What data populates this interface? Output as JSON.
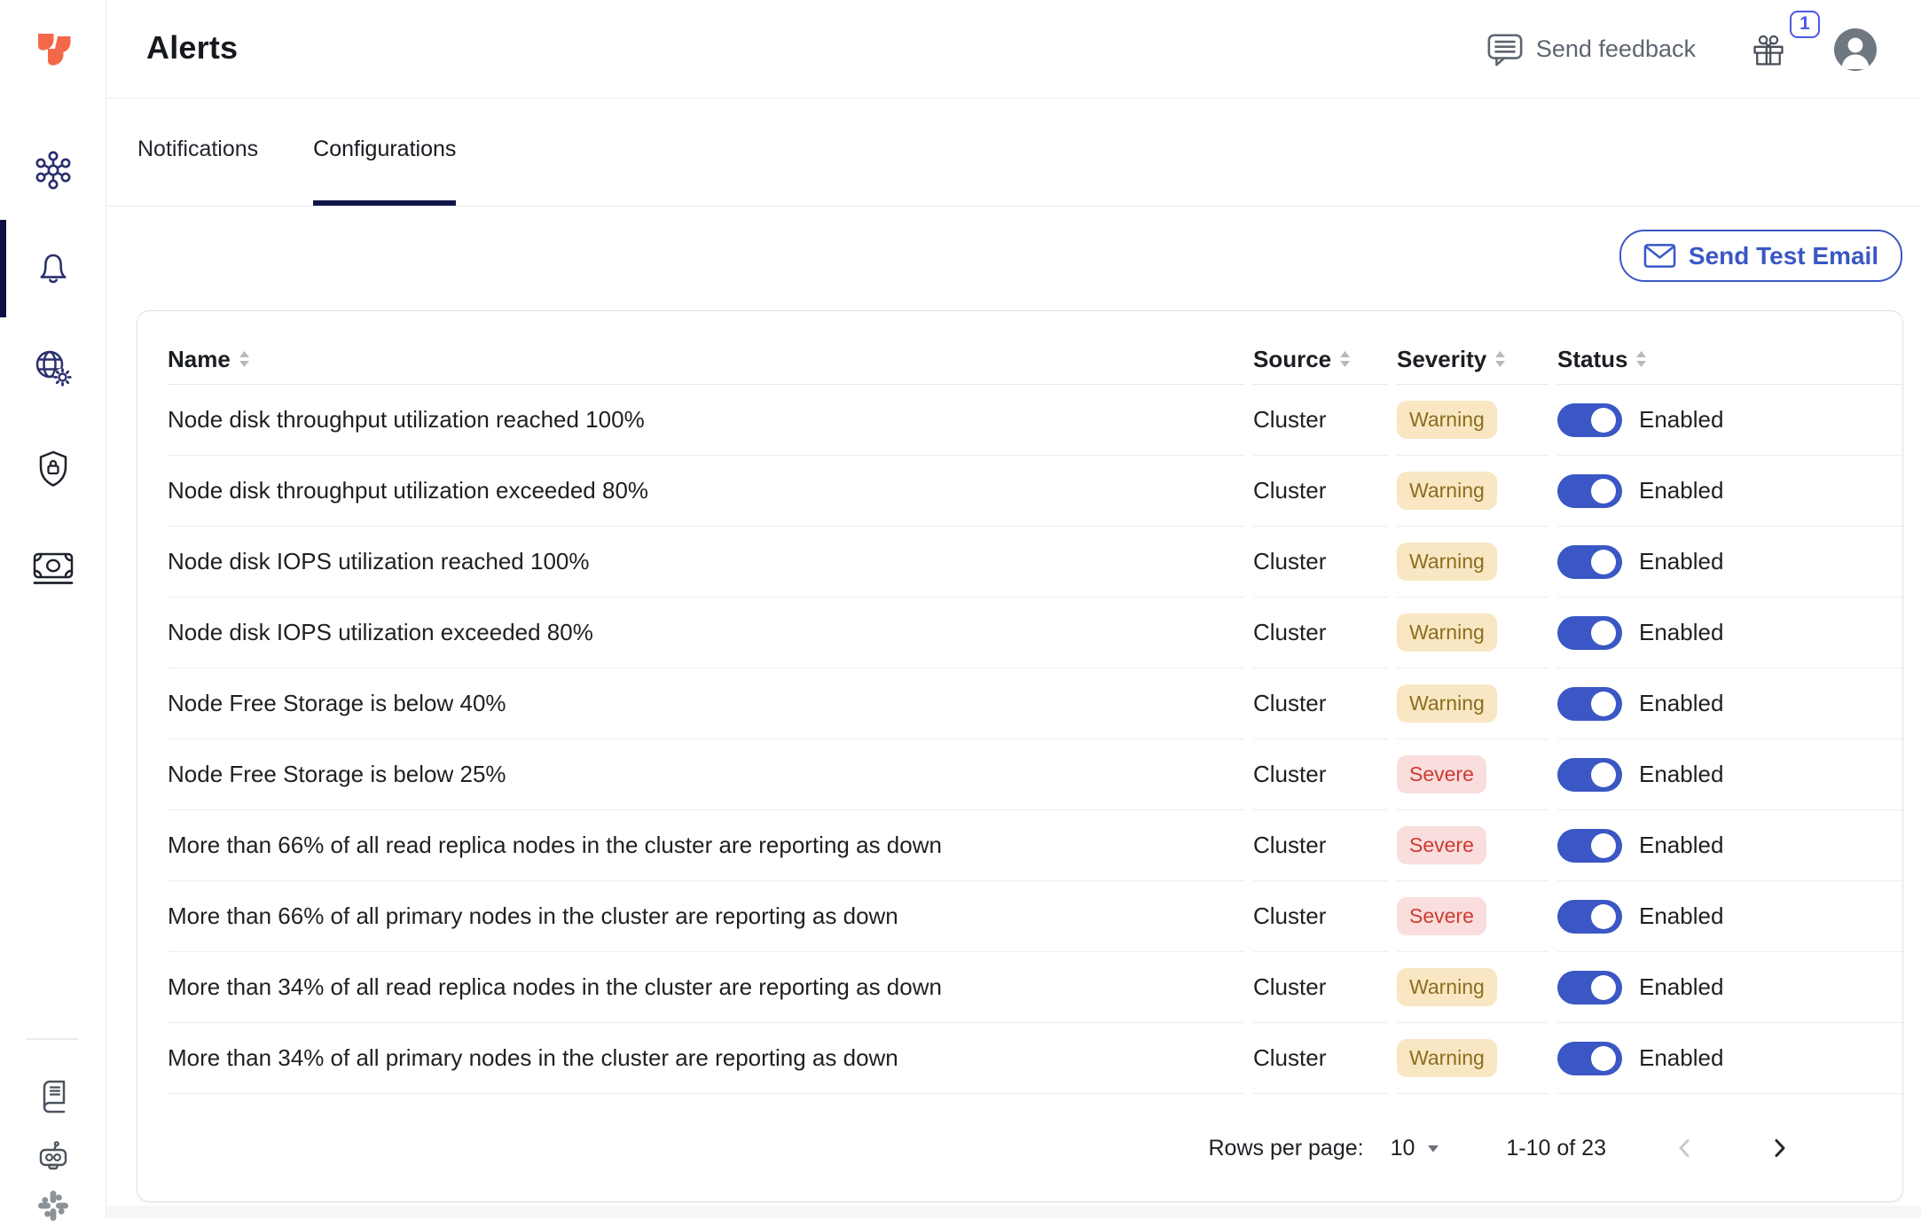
{
  "page": {
    "title": "Alerts"
  },
  "header": {
    "feedback_label": "Send feedback",
    "gift_badge_count": "1"
  },
  "tabs": {
    "notifications": "Notifications",
    "configurations": "Configurations"
  },
  "actions": {
    "send_test_email": "Send Test Email"
  },
  "sidebar_icons": [
    "brand-logo",
    "cluster",
    "alerts-bell",
    "network-settings",
    "security-shield",
    "billing",
    "docs-book",
    "support-bot",
    "slack"
  ],
  "table": {
    "headers": {
      "name": "Name",
      "source": "Source",
      "severity": "Severity",
      "status": "Status"
    },
    "rows": [
      {
        "name": "Node disk throughput utilization reached 100%",
        "source": "Cluster",
        "severity": "Warning",
        "status": "Enabled"
      },
      {
        "name": "Node disk throughput utilization exceeded 80%",
        "source": "Cluster",
        "severity": "Warning",
        "status": "Enabled"
      },
      {
        "name": "Node disk IOPS utilization reached 100%",
        "source": "Cluster",
        "severity": "Warning",
        "status": "Enabled"
      },
      {
        "name": "Node disk IOPS utilization exceeded 80%",
        "source": "Cluster",
        "severity": "Warning",
        "status": "Enabled"
      },
      {
        "name": "Node Free Storage is below 40%",
        "source": "Cluster",
        "severity": "Warning",
        "status": "Enabled"
      },
      {
        "name": "Node Free Storage is below 25%",
        "source": "Cluster",
        "severity": "Severe",
        "status": "Enabled"
      },
      {
        "name": "More than 66% of all read replica nodes in the cluster are reporting as down",
        "source": "Cluster",
        "severity": "Severe",
        "status": "Enabled"
      },
      {
        "name": "More than 66% of all primary nodes in the cluster are reporting as down",
        "source": "Cluster",
        "severity": "Severe",
        "status": "Enabled"
      },
      {
        "name": "More than 34% of all read replica nodes in the cluster are reporting as down",
        "source": "Cluster",
        "severity": "Warning",
        "status": "Enabled"
      },
      {
        "name": "More than 34% of all primary nodes in the cluster are reporting as down",
        "source": "Cluster",
        "severity": "Warning",
        "status": "Enabled"
      }
    ]
  },
  "pagination": {
    "rows_per_page_label": "Rows per page:",
    "rows_per_page_value": "10",
    "range": "1-10 of 23"
  },
  "colors": {
    "accent_blue": "#3a57c5",
    "accent_indigo": "#4c59e5",
    "brand_orange": "#f4684a",
    "navy_icon": "#2a2f6e",
    "warning_bg": "#f8e7c2",
    "warning_text": "#8c6d1e",
    "severe_bg": "#f9dedd",
    "severe_text": "#cf3a31"
  }
}
